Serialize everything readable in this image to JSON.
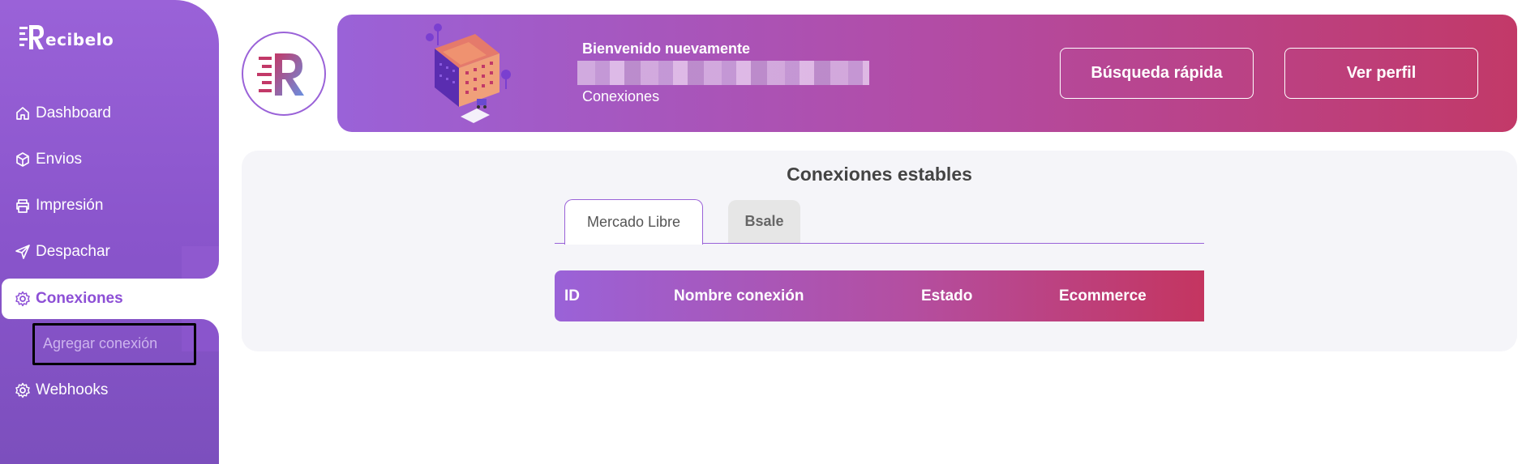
{
  "app": {
    "logo_text": "ecibelo",
    "logo_letter": "R"
  },
  "sidebar": {
    "items": [
      {
        "label": "Dashboard",
        "icon": "home-icon"
      },
      {
        "label": "Envios",
        "icon": "box-icon"
      },
      {
        "label": "Impresión",
        "icon": "printer-icon"
      },
      {
        "label": "Despachar",
        "icon": "send-icon"
      },
      {
        "label": "Conexiones",
        "icon": "gear-icon",
        "active": true
      },
      {
        "label": "Webhooks",
        "icon": "gear-icon"
      }
    ],
    "subitem": {
      "label": "Agregar conexión"
    }
  },
  "header": {
    "welcome": "Bienvenido nuevamente",
    "section": "Conexiones",
    "search_button": "Búsqueda rápida",
    "profile_button": "Ver perfil"
  },
  "main": {
    "title": "Conexiones estables",
    "tabs": [
      {
        "label": "Mercado Libre",
        "active": true
      },
      {
        "label": "Bsale",
        "active": false
      }
    ],
    "table": {
      "columns": [
        "ID",
        "Nombre conexión",
        "Estado",
        "Ecommerce"
      ]
    }
  },
  "colors": {
    "primary": "#9a62d8",
    "secondary": "#c23968",
    "active_text": "#8d4fd6"
  }
}
